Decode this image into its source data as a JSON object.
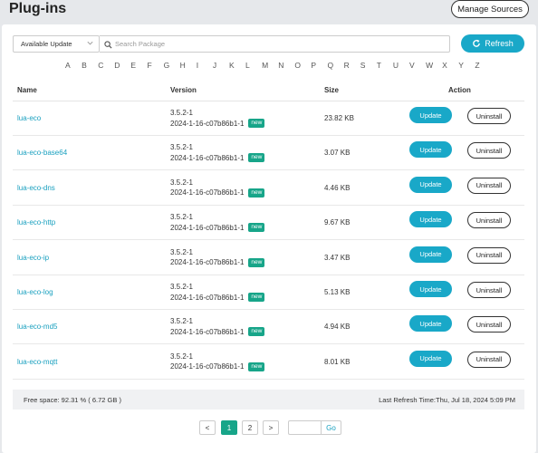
{
  "header": {
    "title": "Plug-ins",
    "manage_label": "Manage Sources"
  },
  "toolbar": {
    "filter_value": "Available Update",
    "search_placeholder": "Search Package",
    "refresh_label": "Refresh"
  },
  "alphabet": [
    "A",
    "B",
    "C",
    "D",
    "E",
    "F",
    "G",
    "H",
    "I",
    "J",
    "K",
    "L",
    "M",
    "N",
    "O",
    "P",
    "Q",
    "R",
    "S",
    "T",
    "U",
    "V",
    "W",
    "X",
    "Y",
    "Z"
  ],
  "table": {
    "columns": [
      "Name",
      "Version",
      "Size",
      "Action"
    ],
    "update_label": "Update",
    "uninstall_label": "Uninstall",
    "badge_label": "new",
    "rows": [
      {
        "name": "lua-eco",
        "version": "3.5.2-1",
        "build": "2024-1-16-c07b86b1-1",
        "size": "23.82 KB"
      },
      {
        "name": "lua-eco-base64",
        "version": "3.5.2-1",
        "build": "2024-1-16-c07b86b1-1",
        "size": "3.07 KB"
      },
      {
        "name": "lua-eco-dns",
        "version": "3.5.2-1",
        "build": "2024-1-16-c07b86b1-1",
        "size": "4.46 KB"
      },
      {
        "name": "lua-eco-http",
        "version": "3.5.2-1",
        "build": "2024-1-16-c07b86b1-1",
        "size": "9.67 KB"
      },
      {
        "name": "lua-eco-ip",
        "version": "3.5.2-1",
        "build": "2024-1-16-c07b86b1-1",
        "size": "3.47 KB"
      },
      {
        "name": "lua-eco-log",
        "version": "3.5.2-1",
        "build": "2024-1-16-c07b86b1-1",
        "size": "5.13 KB"
      },
      {
        "name": "lua-eco-md5",
        "version": "3.5.2-1",
        "build": "2024-1-16-c07b86b1-1",
        "size": "4.94 KB"
      },
      {
        "name": "lua-eco-mqtt",
        "version": "3.5.2-1",
        "build": "2024-1-16-c07b86b1-1",
        "size": "8.01 KB"
      }
    ]
  },
  "footer": {
    "free_space": "Free space: 92.31 % ( 6.72 GB )",
    "last_refresh": "Last Refresh Time:Thu, Jul 18, 2024 5:09 PM"
  },
  "pager": {
    "prev": "<",
    "pages": [
      "1",
      "2"
    ],
    "current": "1",
    "next": ">",
    "go_label": "Go"
  },
  "colors": {
    "accent": "#19a8c8",
    "badge": "#17a589",
    "link": "#19a0bf"
  }
}
